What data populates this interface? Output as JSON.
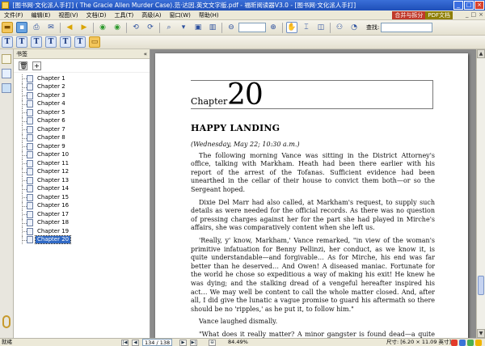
{
  "window": {
    "title": "[图书网·文化派人手打]  ( The Gracie Allen Murder Case).范·达因.英文文字版.pdf - 福昕阅读器V3.0 - [图书网·文化派人手打]",
    "btn_min": "_",
    "btn_max": "□",
    "btn_close": "×"
  },
  "menu": {
    "items": [
      "文件(F)",
      "编辑(E)",
      "视图(V)",
      "文档(D)",
      "工具(T)",
      "高级(A)",
      "窗口(W)",
      "帮助(H)"
    ],
    "promo_a": "合并与拆分",
    "promo_b": "PDF文档",
    "mini": [
      "_",
      "□",
      "×"
    ]
  },
  "toolbar": {
    "zoom": "",
    "search_label": "查找:",
    "search_placeholder": ""
  },
  "bookmarks": {
    "title": "书签",
    "collapse": "«",
    "items": [
      "Chapter 1",
      "Chapter 2",
      "Chapter 3",
      "Chapter 4",
      "Chapter 5",
      "Chapter 6",
      "Chapter 7",
      "Chapter 8",
      "Chapter 9",
      "Chapter 10",
      "Chapter 11",
      "Chapter 12",
      "Chapter 13",
      "Chapter 14",
      "Chapter 15",
      "Chapter 16",
      "Chapter 17",
      "Chapter 18",
      "Chapter 19",
      "Chapter 20"
    ],
    "selected_index": 19
  },
  "page": {
    "chapter_word": "Chapter",
    "chapter_number": "20",
    "heading": "HAPPY LANDING",
    "dateline": "(Wednesday, May 22; 10:30 a.m.)",
    "paragraphs": [
      "The following morning Vance was sitting in the District Attorney's office, talking with Markham. Heath had been there earlier with his report of the arrest of the Tofanas. Sufficient evidence had been unearthed in the cellar of their house to convict them both—or so the Sergeant hoped.",
      "Dixie Del Marr had also called, at Markham's request, to supply such details as were needed for the official records. As there was no question of pressing charges against her for the part she had played in Mirche's affairs, she was comparatively content when she left us.",
      "'Really, y' know, Markham,' Vance remarked, \"in view of the woman's primitive infatuation for Benny Pellinzi, her conduct, as we know it, is quite understandable—and forgivable… As for Mirche, his end was far better than he deserved… And Owen! A diseased maniac. Fortunate for the world he chose so expeditious a way of making his exit! He knew he was dying; and the stalking dread of a vengeful hereafter inspired his act… We may well be content to call the whole matter closed. And, after all, I did give the lunatic a vague promise to guard his aftermath so there should be no 'ripples,' as he put it, to follow him.\"",
      "Vance laughed dismally.",
      "\"What does it really matter? A minor gangster is found dead—a quite commonplace event: a major gangster is shot—also an ordinary"
    ]
  },
  "status": {
    "ready": "就绪",
    "page_indicator": "134 / 138",
    "zoom": "84.49%",
    "size": "尺寸: [6.20 × 11.09 英寸]"
  },
  "colors": {
    "titlebar": "#1f4fb8",
    "selection": "#316ac5",
    "doc_background": "#8c8c8c"
  }
}
